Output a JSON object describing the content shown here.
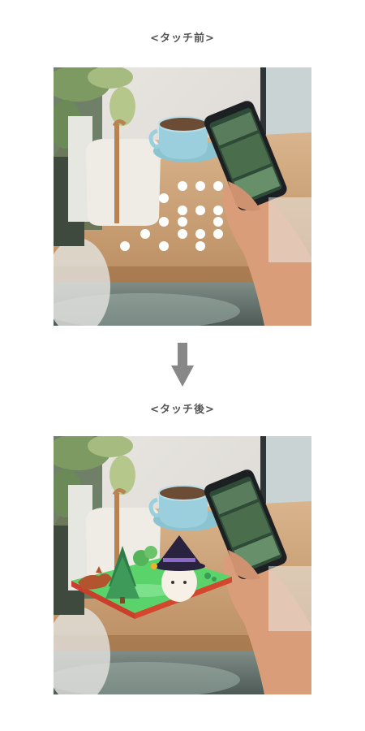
{
  "captions": {
    "before": "<タッチ前>",
    "after": "<タッチ後>"
  },
  "colors": {
    "caption": "#555555",
    "arrow": "#888888",
    "table": "#c9a07a",
    "dots": "#ffffff",
    "island_grass": "#5ad36a",
    "island_base": "#e2503b"
  },
  "icons": {
    "arrow": "down-arrow-icon",
    "dots": "touch-point-icon",
    "ar_scene": "ar-island-scene"
  },
  "touch_point_count": 17
}
